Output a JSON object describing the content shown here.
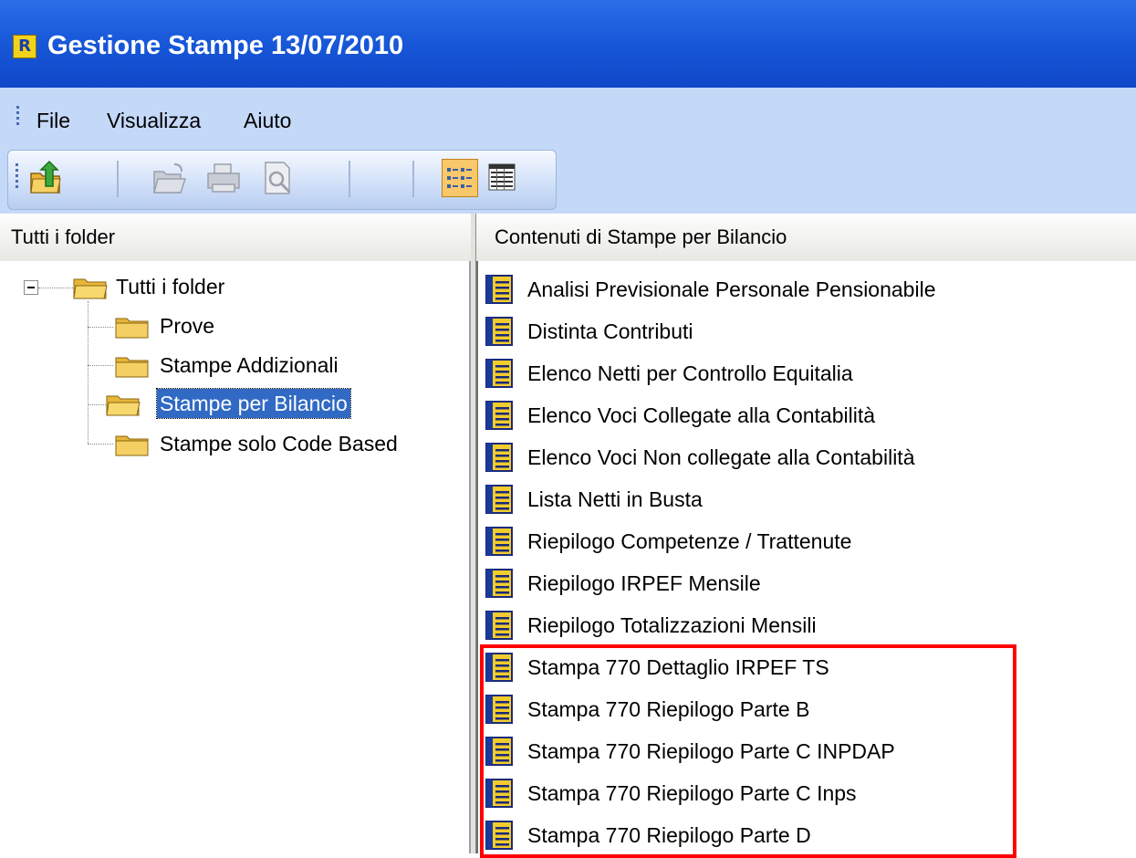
{
  "window": {
    "title": "Gestione Stampe 13/07/2010",
    "icon_letter": "R",
    "icon": "app-r-icon"
  },
  "menu": {
    "items": [
      {
        "label": "File"
      },
      {
        "label": "Visualizza"
      },
      {
        "label": "Aiuto"
      }
    ]
  },
  "toolbar": {
    "buttons": [
      {
        "icon": "folder-up-icon",
        "enabled": true
      },
      {
        "icon": "open-folder-icon",
        "enabled": false
      },
      {
        "icon": "print-icon",
        "enabled": false
      },
      {
        "icon": "print-preview-icon",
        "enabled": false
      },
      {
        "icon": "list-view-icon",
        "enabled": true,
        "active": true
      },
      {
        "icon": "details-view-icon",
        "enabled": true
      }
    ]
  },
  "left_pane": {
    "header": "Tutti i folder",
    "tree": {
      "root": "Tutti i folder",
      "children": [
        {
          "label": "Prove",
          "selected": false
        },
        {
          "label": "Stampe Addizionali",
          "selected": false
        },
        {
          "label": "Stampe per Bilancio",
          "selected": true
        },
        {
          "label": "Stampe solo Code Based",
          "selected": false
        }
      ]
    }
  },
  "right_pane": {
    "header": "Contenuti di Stampe per Bilancio",
    "items": [
      "Analisi Previsionale Personale Pensionabile",
      "Distinta Contributi",
      "Elenco Netti per Controllo Equitalia",
      "Elenco Voci Collegate alla Contabilità",
      "Elenco Voci Non collegate alla Contabilità",
      "Lista Netti in Busta",
      "Riepilogo Competenze / Trattenute",
      "Riepilogo IRPEF Mensile",
      "Riepilogo Totalizzazioni Mensili",
      "Stampa 770 Dettaglio IRPEF TS",
      "Stampa 770 Riepilogo Parte B",
      "Stampa 770 Riepilogo Parte C INPDAP",
      "Stampa 770 Riepilogo Parte C Inps",
      "Stampa 770 Riepilogo Parte D"
    ],
    "highlight_color": "#ff0000"
  },
  "colors": {
    "titlebar": "#1757d8",
    "menubar": "#c4d8f8",
    "selection": "#316ac5"
  }
}
